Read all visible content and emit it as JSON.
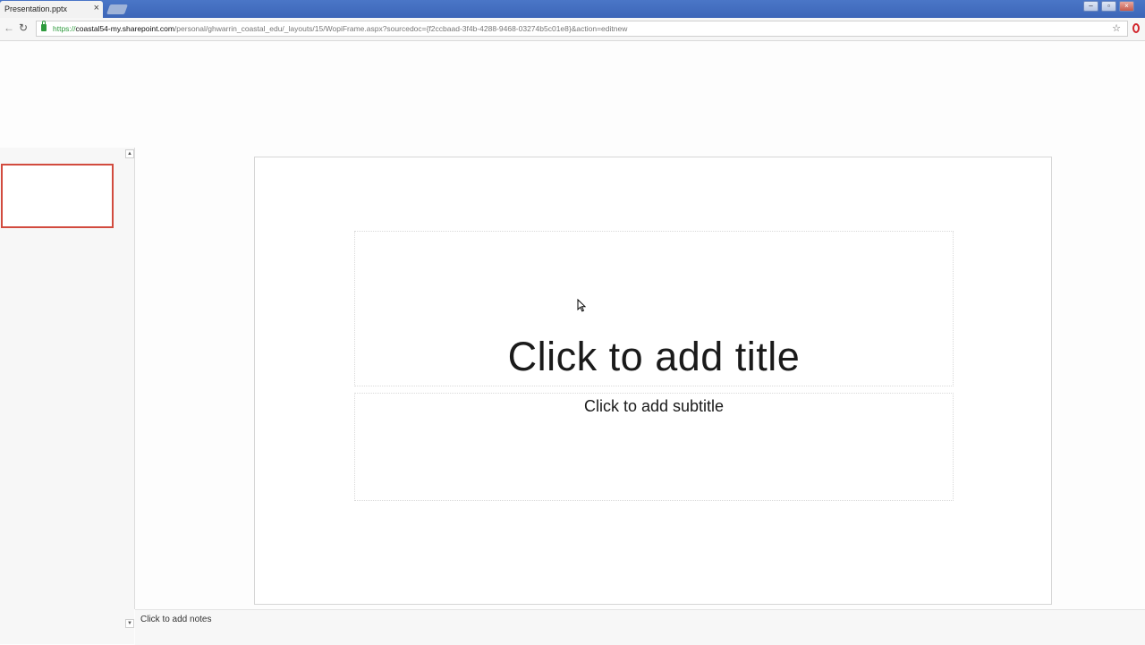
{
  "browser": {
    "tab_title": "Presentation.pptx",
    "tab_close": "×",
    "url_scheme": "https://",
    "url_host": "coastal54-my.sharepoint.com",
    "url_path": "/personal/ghwarrin_coastal_edu/_layouts/15/WopiFrame.aspx?sourcedoc={f2ccbaad-3f4b-4288-9468-03274b5c01e8}&action=editnew",
    "back_icon": "←",
    "reload_icon": "↻",
    "star_icon": "☆",
    "window_controls": {
      "minimize": "–",
      "restore": "▫",
      "close": "×"
    }
  },
  "thumbnails": {
    "scroll_up": "▲",
    "scroll_down": "▼"
  },
  "slide": {
    "title_placeholder": "Click to add title",
    "subtitle_placeholder": "Click to add subtitle"
  },
  "notes": {
    "placeholder": "Click to add notes"
  },
  "colors": {
    "thumbnail_selection": "#d24b3e",
    "titlebar": "#4a76c7"
  }
}
